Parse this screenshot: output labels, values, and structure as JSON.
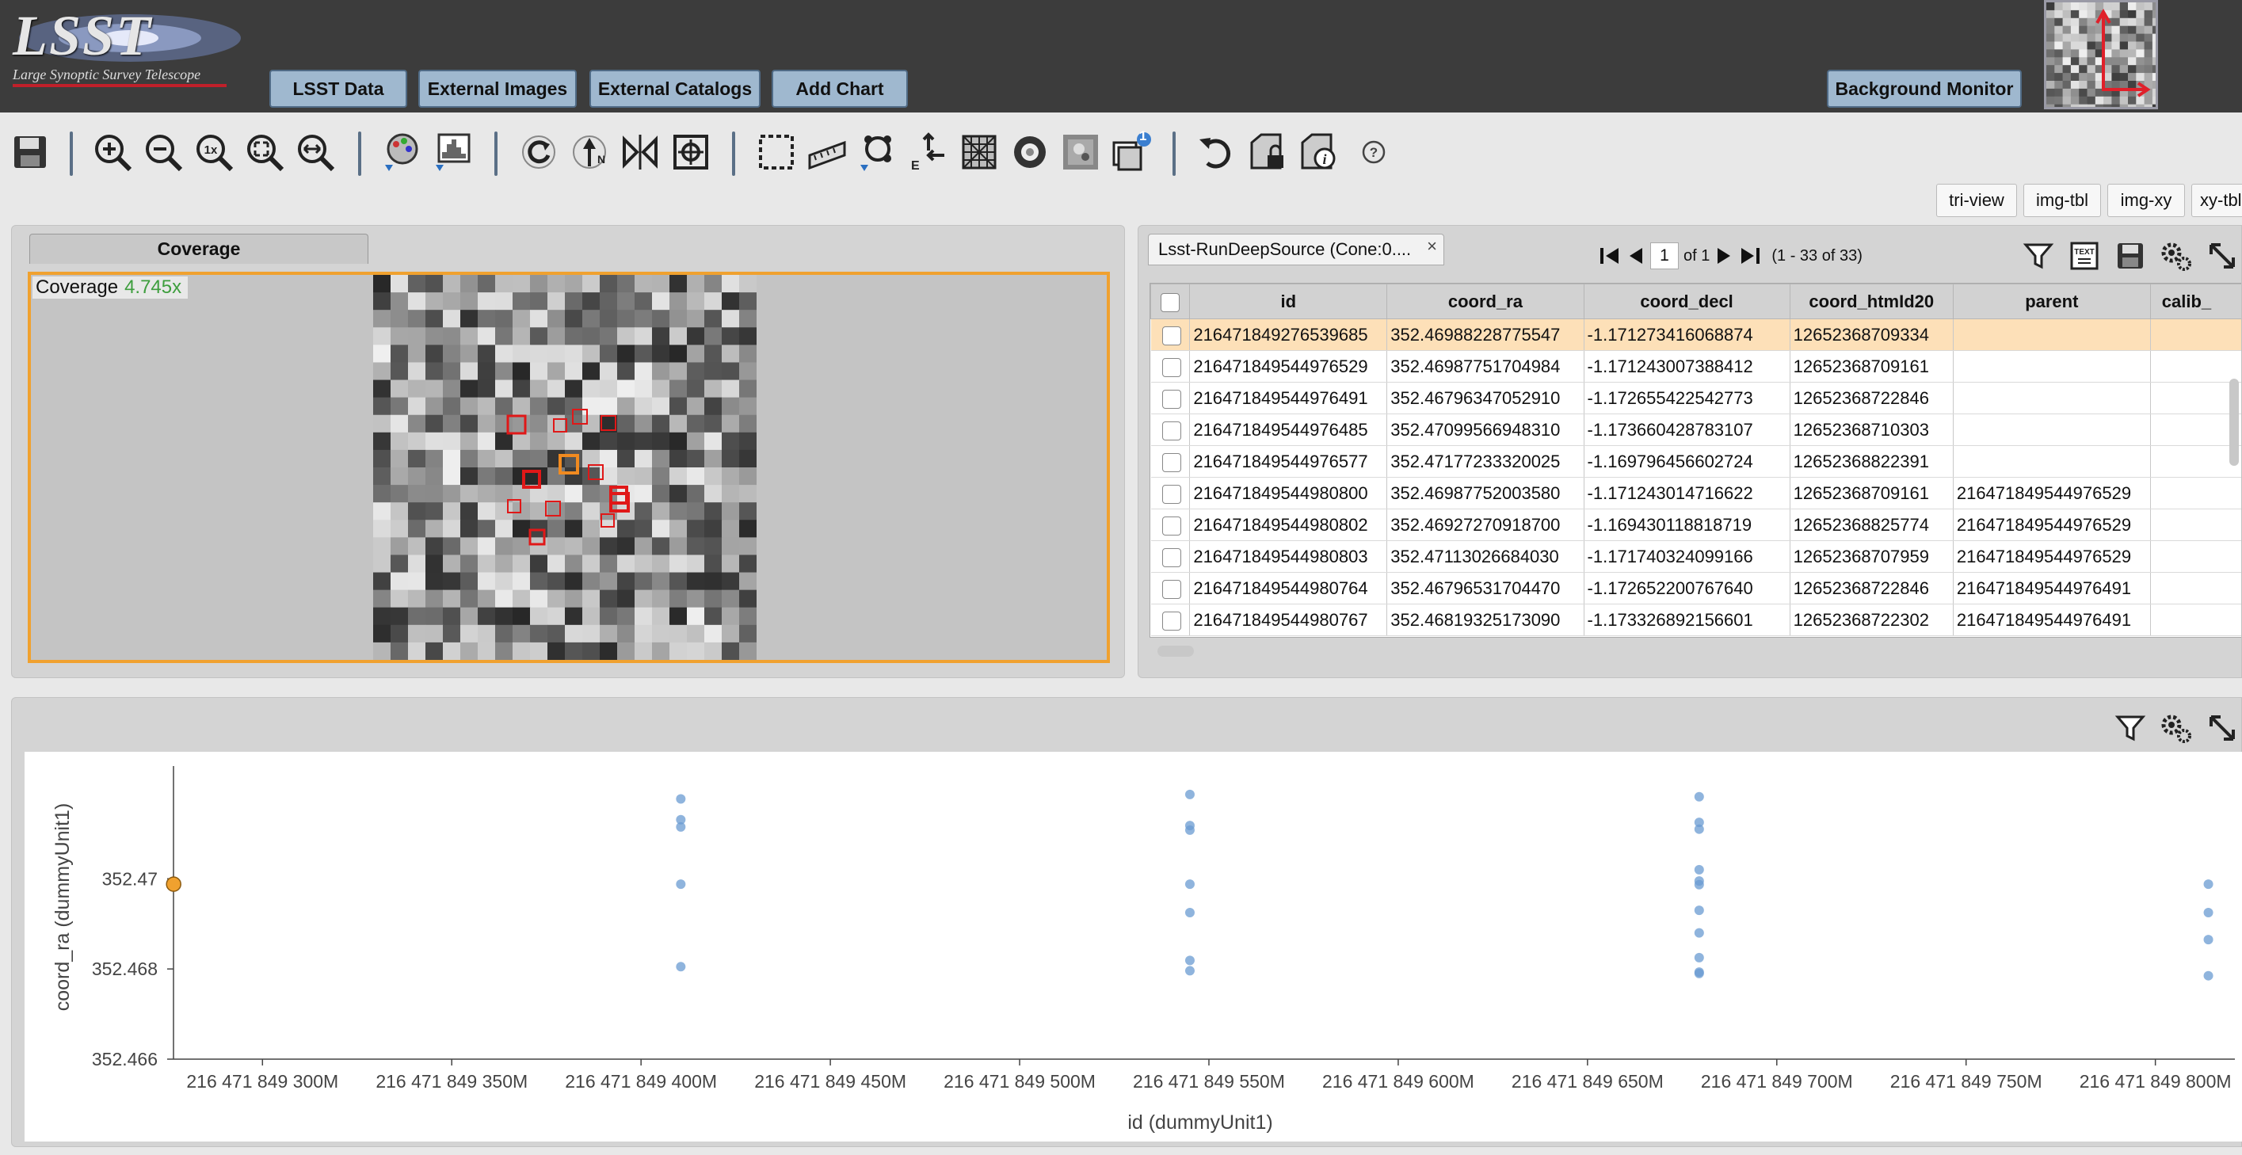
{
  "header": {
    "logo_text": "LSST",
    "logo_tagline": "Large Synoptic Survey Telescope",
    "buttons": [
      "LSST Data",
      "External Images",
      "External Catalogs",
      "Add Chart"
    ],
    "background_monitor": "Background Monitor"
  },
  "toolbar": {
    "icons": [
      "save-icon",
      "zoom-in-icon",
      "zoom-out-icon",
      "zoom-1x-icon",
      "zoom-fit-icon",
      "zoom-fill-icon",
      "color-palette-icon",
      "stretch-icon",
      "rotate-icon",
      "north-arrow-icon",
      "flip-icon",
      "center-target-icon",
      "select-area-icon",
      "distance-tool-icon",
      "markers-icon",
      "layers-arrow-icon",
      "grid-icon",
      "mask-icon",
      "image-select-icon",
      "layers-icon",
      "undo-icon",
      "lock-icon",
      "image-info-icon",
      "help-icon"
    ],
    "layers_badge": "1",
    "help_label": "?",
    "zoom_1x_label": "1x"
  },
  "view_buttons": [
    "tri-view",
    "img-tbl",
    "img-xy",
    "xy-tbl"
  ],
  "coverage": {
    "tab_label": "Coverage",
    "label": "Coverage",
    "zoom": "4.745x"
  },
  "table": {
    "tab_label": "Lsst-RunDeepSource (Cone:0....",
    "close": "×",
    "page_value": "1",
    "page_of": "of 1",
    "range": "(1 - 33 of 33)",
    "columns": [
      "id",
      "coord_ra",
      "coord_decl",
      "coord_htmId20",
      "parent",
      "calib_"
    ],
    "rows": [
      [
        "216471849276539685",
        "352.46988228775547",
        "-1.171273416068874",
        "12652368709334",
        ""
      ],
      [
        "216471849544976529",
        "352.46987751704984",
        "-1.171243007388412",
        "12652368709161",
        ""
      ],
      [
        "216471849544976491",
        "352.46796347052910",
        "-1.172655422542773",
        "12652368722846",
        ""
      ],
      [
        "216471849544976485",
        "352.47099566948310",
        "-1.173660428783107",
        "12652368710303",
        ""
      ],
      [
        "216471849544976577",
        "352.47177233320025",
        "-1.169796456602724",
        "12652368822391",
        ""
      ],
      [
        "216471849544980800",
        "352.46987752003580",
        "-1.171243014716622",
        "12652368709161",
        "216471849544976529"
      ],
      [
        "216471849544980802",
        "352.46927270918700",
        "-1.169430118818719",
        "12652368825774",
        "216471849544976529"
      ],
      [
        "216471849544980803",
        "352.47113026684030",
        "-1.171740324099166",
        "12652368707959",
        "216471849544976529"
      ],
      [
        "216471849544980764",
        "352.46796531704470",
        "-1.172652200767640",
        "12652368722846",
        "216471849544976491"
      ],
      [
        "216471849544980767",
        "352.46819325173090",
        "-1.173326892156601",
        "12652368722302",
        "216471849544976491"
      ]
    ]
  },
  "chart_data": {
    "type": "scatter",
    "xlabel": "id (dummyUnit1)",
    "ylabel": "coord_ra (dummyUnit1)",
    "xlim": [
      216471849276500000,
      216471849821000000
    ],
    "ylim": [
      352.466,
      352.4725
    ],
    "x_ticks": [
      "216 471 849 300M",
      "216 471 849 350M",
      "216 471 849 400M",
      "216 471 849 450M",
      "216 471 849 500M",
      "216 471 849 550M",
      "216 471 849 600M",
      "216 471 849 650M",
      "216 471 849 700M",
      "216 471 849 750M",
      "216 471 849 800M"
    ],
    "x_tick_values": [
      216471849300000000,
      216471849350000000,
      216471849400000000,
      216471849450000000,
      216471849500000000,
      216471849550000000,
      216471849600000000,
      216471849650000000,
      216471849700000000,
      216471849750000000,
      216471849800000000
    ],
    "y_ticks": [
      "352.466",
      "352.468",
      "352.47"
    ],
    "y_tick_values": [
      352.466,
      352.468,
      352.47
    ],
    "highlighted": {
      "x": 216471849276539685,
      "y": 352.46988,
      "color": "#f0a12f"
    },
    "point_color": "#6a9bd1",
    "points": [
      {
        "x": 216471849410500000,
        "y": 352.47177
      },
      {
        "x": 216471849410500000,
        "y": 352.47131
      },
      {
        "x": 216471849410500000,
        "y": 352.47115
      },
      {
        "x": 216471849410500000,
        "y": 352.46988
      },
      {
        "x": 216471849410500000,
        "y": 352.46805
      },
      {
        "x": 216471849544976529,
        "y": 352.47187
      },
      {
        "x": 216471849544976529,
        "y": 352.47118
      },
      {
        "x": 216471849544976529,
        "y": 352.47108
      },
      {
        "x": 216471849544976529,
        "y": 352.46988
      },
      {
        "x": 216471849544976529,
        "y": 352.46925
      },
      {
        "x": 216471849544976529,
        "y": 352.46819
      },
      {
        "x": 216471849544976529,
        "y": 352.46796
      },
      {
        "x": 216471849679500000,
        "y": 352.47182
      },
      {
        "x": 216471849679500000,
        "y": 352.47125
      },
      {
        "x": 216471849679500000,
        "y": 352.4711
      },
      {
        "x": 216471849679500000,
        "y": 352.4702
      },
      {
        "x": 216471849679500000,
        "y": 352.46995
      },
      {
        "x": 216471849679500000,
        "y": 352.46987
      },
      {
        "x": 216471849679500000,
        "y": 352.4693
      },
      {
        "x": 216471849679500000,
        "y": 352.4688
      },
      {
        "x": 216471849679500000,
        "y": 352.46825
      },
      {
        "x": 216471849679500000,
        "y": 352.46793
      },
      {
        "x": 216471849679500000,
        "y": 352.4679
      },
      {
        "x": 216471849814000000,
        "y": 352.46988
      },
      {
        "x": 216471849814000000,
        "y": 352.46925
      },
      {
        "x": 216471849814000000,
        "y": 352.46865
      },
      {
        "x": 216471849814000000,
        "y": 352.46785
      }
    ]
  }
}
